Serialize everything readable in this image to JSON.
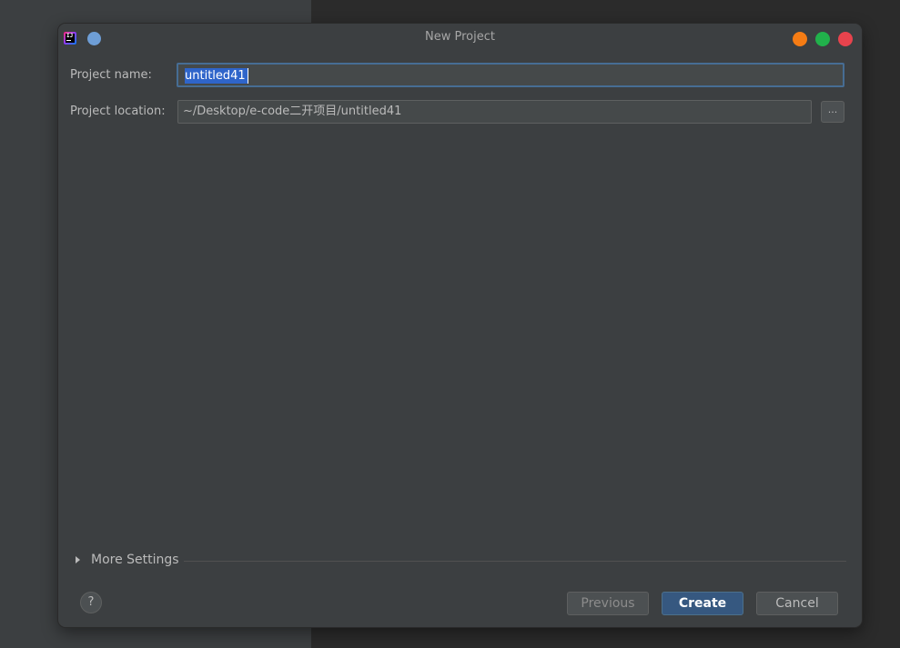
{
  "window": {
    "title": "New Project",
    "controls": {
      "minimize_color": "#f57c14",
      "maximize_color": "#21b14b",
      "close_color": "#e8434d"
    },
    "app_icon": "intellij-idea-icon",
    "pin_icon": "pin-dot-icon"
  },
  "form": {
    "name_label": "Project name:",
    "name_value": "untitled41",
    "location_label": "Project location:",
    "location_value": "~/Desktop/e-code二开项目/untitled41",
    "browse_label": "..."
  },
  "more_settings": {
    "label": "More Settings",
    "icon": "expand-triangle-icon"
  },
  "footer": {
    "help_label": "?",
    "previous_label": "Previous",
    "create_label": "Create",
    "cancel_label": "Cancel"
  },
  "colors": {
    "dialog_bg": "#3c3f41",
    "input_bg": "#45494a",
    "focus_border": "#466d94",
    "selection": "#2f65ca",
    "default_button": "#365880"
  }
}
